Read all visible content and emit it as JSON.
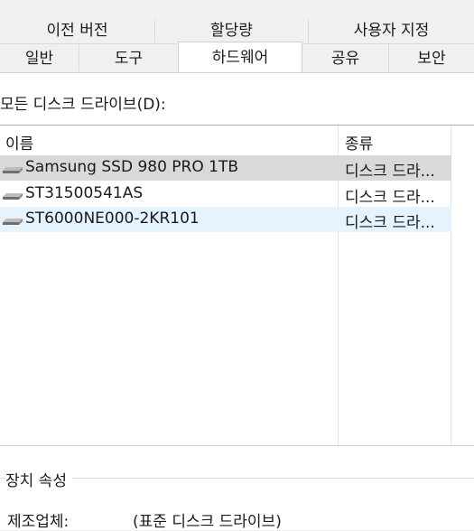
{
  "tabs_row1": [
    "이전 버전",
    "할당량",
    "사용자 지정"
  ],
  "tabs_row2": [
    "일반",
    "도구",
    "하드웨어",
    "공유",
    "보안"
  ],
  "drive_list_label": "모든 디스크 드라이브(D):",
  "columns": {
    "name": "이름",
    "type": "종류"
  },
  "drives": [
    {
      "name": "Samsung SSD 980 PRO 1TB",
      "type": "디스크 드라...",
      "icon": "drive-icon"
    },
    {
      "name": "ST31500541AS",
      "type": "디스크 드라...",
      "icon": "drive-icon"
    },
    {
      "name": "ST6000NE000-2KR101",
      "type": "디스크 드라...",
      "icon": "drive-icon"
    }
  ],
  "properties": {
    "title": "장치 속성",
    "manufacturer_label": "제조업체:",
    "manufacturer_value": "(표준 디스크 드라이브)"
  }
}
